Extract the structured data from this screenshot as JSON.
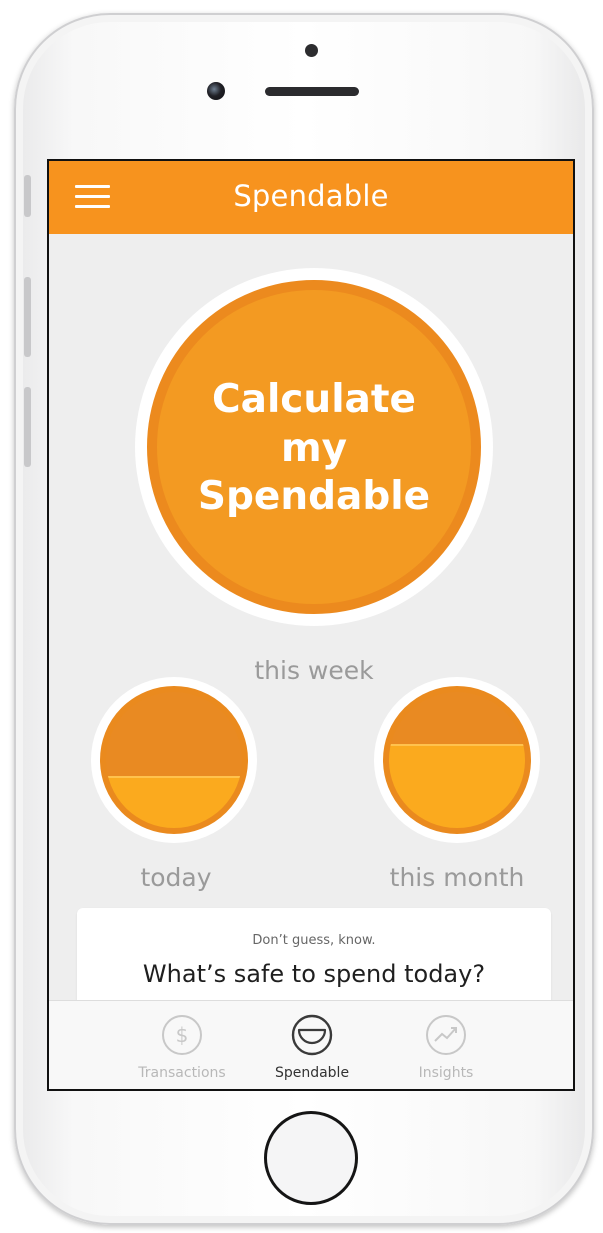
{
  "app": {
    "title": "Spendable",
    "accent_color": "#f7931e",
    "menu_icon": "hamburger-menu-icon"
  },
  "main_circle": {
    "label": "Calculate my Spendable"
  },
  "periods": {
    "week_label": "this week",
    "today_label": "today",
    "month_label": "this month",
    "today_fill_fraction": 0.38,
    "month_fill_fraction": 0.62
  },
  "promo_card": {
    "subtitle": "Don’t guess, know.",
    "headline": "What’s safe to spend today?"
  },
  "tabs": [
    {
      "label": "Transactions",
      "icon": "dollar-circle-icon",
      "active": false
    },
    {
      "label": "Spendable",
      "icon": "spendable-gauge-icon",
      "active": true
    },
    {
      "label": "Insights",
      "icon": "trend-chart-icon",
      "active": false
    }
  ]
}
